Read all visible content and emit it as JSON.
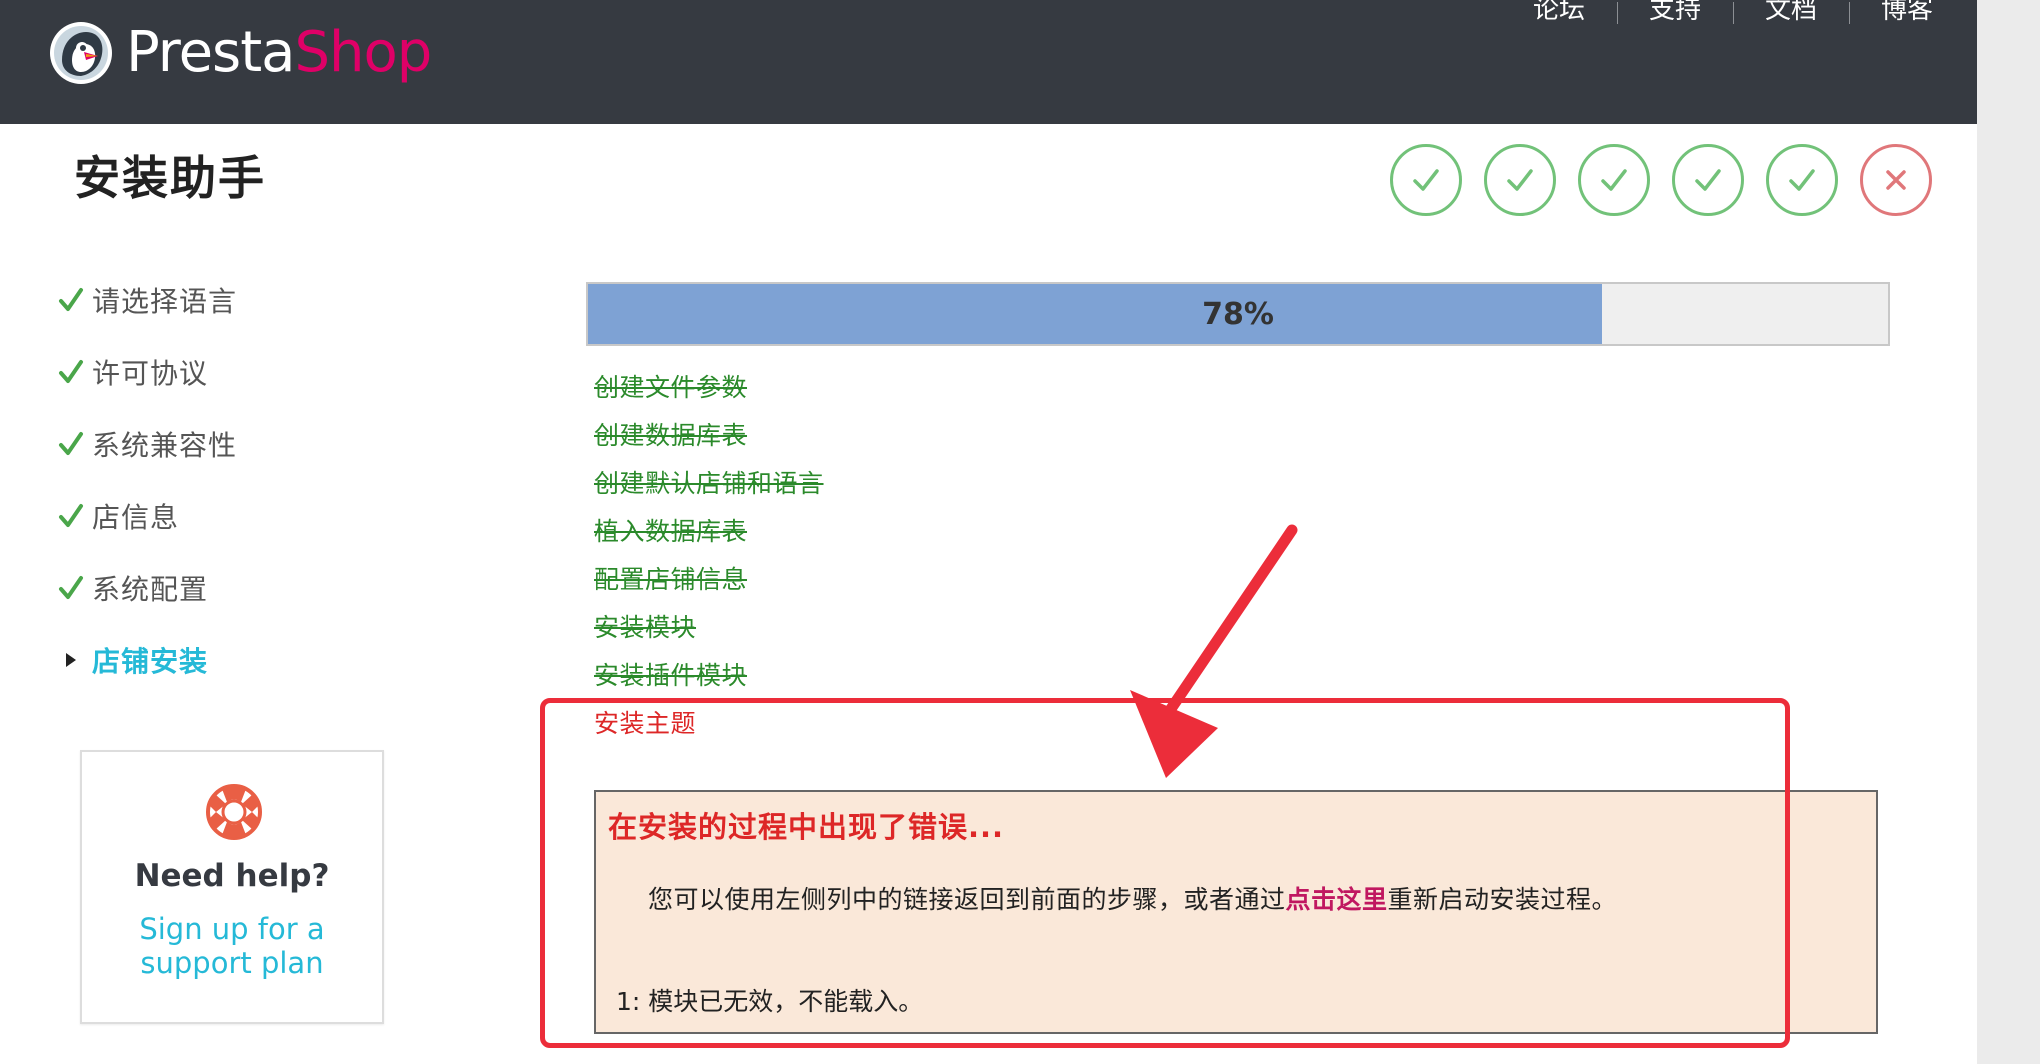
{
  "header": {
    "logo_word_1": "Presta",
    "logo_word_2": "Shop",
    "nav": [
      "论坛",
      "支持",
      "文档",
      "博客"
    ]
  },
  "page_title": "安装助手",
  "step_indicators": [
    {
      "icon": "check-circle-icon",
      "status": "done"
    },
    {
      "icon": "check-circle-icon",
      "status": "done"
    },
    {
      "icon": "check-circle-icon",
      "status": "done"
    },
    {
      "icon": "check-circle-icon",
      "status": "done"
    },
    {
      "icon": "check-circle-icon",
      "status": "done"
    },
    {
      "icon": "x-circle-icon",
      "status": "failed"
    }
  ],
  "sidebar": {
    "items": [
      {
        "label": "请选择语言",
        "status": "done"
      },
      {
        "label": "许可协议",
        "status": "done"
      },
      {
        "label": "系统兼容性",
        "status": "done"
      },
      {
        "label": "店信息",
        "status": "done"
      },
      {
        "label": "系统配置",
        "status": "done"
      },
      {
        "label": "店铺安装",
        "status": "active"
      }
    ]
  },
  "help": {
    "title": "Need help?",
    "link_line_1": "Sign up for a",
    "link_line_2": "support plan"
  },
  "progress": {
    "label": "78%",
    "value": 0.78
  },
  "tasks": [
    {
      "label": "创建文件参数",
      "status": "done"
    },
    {
      "label": "创建数据库表",
      "status": "done"
    },
    {
      "label": "创建默认店铺和语言",
      "status": "done"
    },
    {
      "label": "植入数据库表",
      "status": "done"
    },
    {
      "label": "配置店铺信息",
      "status": "done"
    },
    {
      "label": "安装模块",
      "status": "done"
    },
    {
      "label": "安装插件模块",
      "status": "done"
    },
    {
      "label": "安装主题",
      "status": "current"
    }
  ],
  "error": {
    "title": "在安装的过程中出现了错误...",
    "message_before": "您可以使用左侧列中的链接返回到前面的步骤，或者通过",
    "message_link": "点击这里",
    "message_after": "重新启动安装过程。",
    "detail": "1: 模块已无效，不能载入。"
  },
  "colors": {
    "header_bg": "#363a41",
    "brand_pink": "#df0067",
    "accent_blue": "#25b9d7",
    "success_green": "#2b8a2b",
    "error_red": "#dd2727",
    "annotation_red": "#ec2d3a",
    "progress_fill": "#7ea2d4",
    "error_bg": "#fae8d9"
  }
}
